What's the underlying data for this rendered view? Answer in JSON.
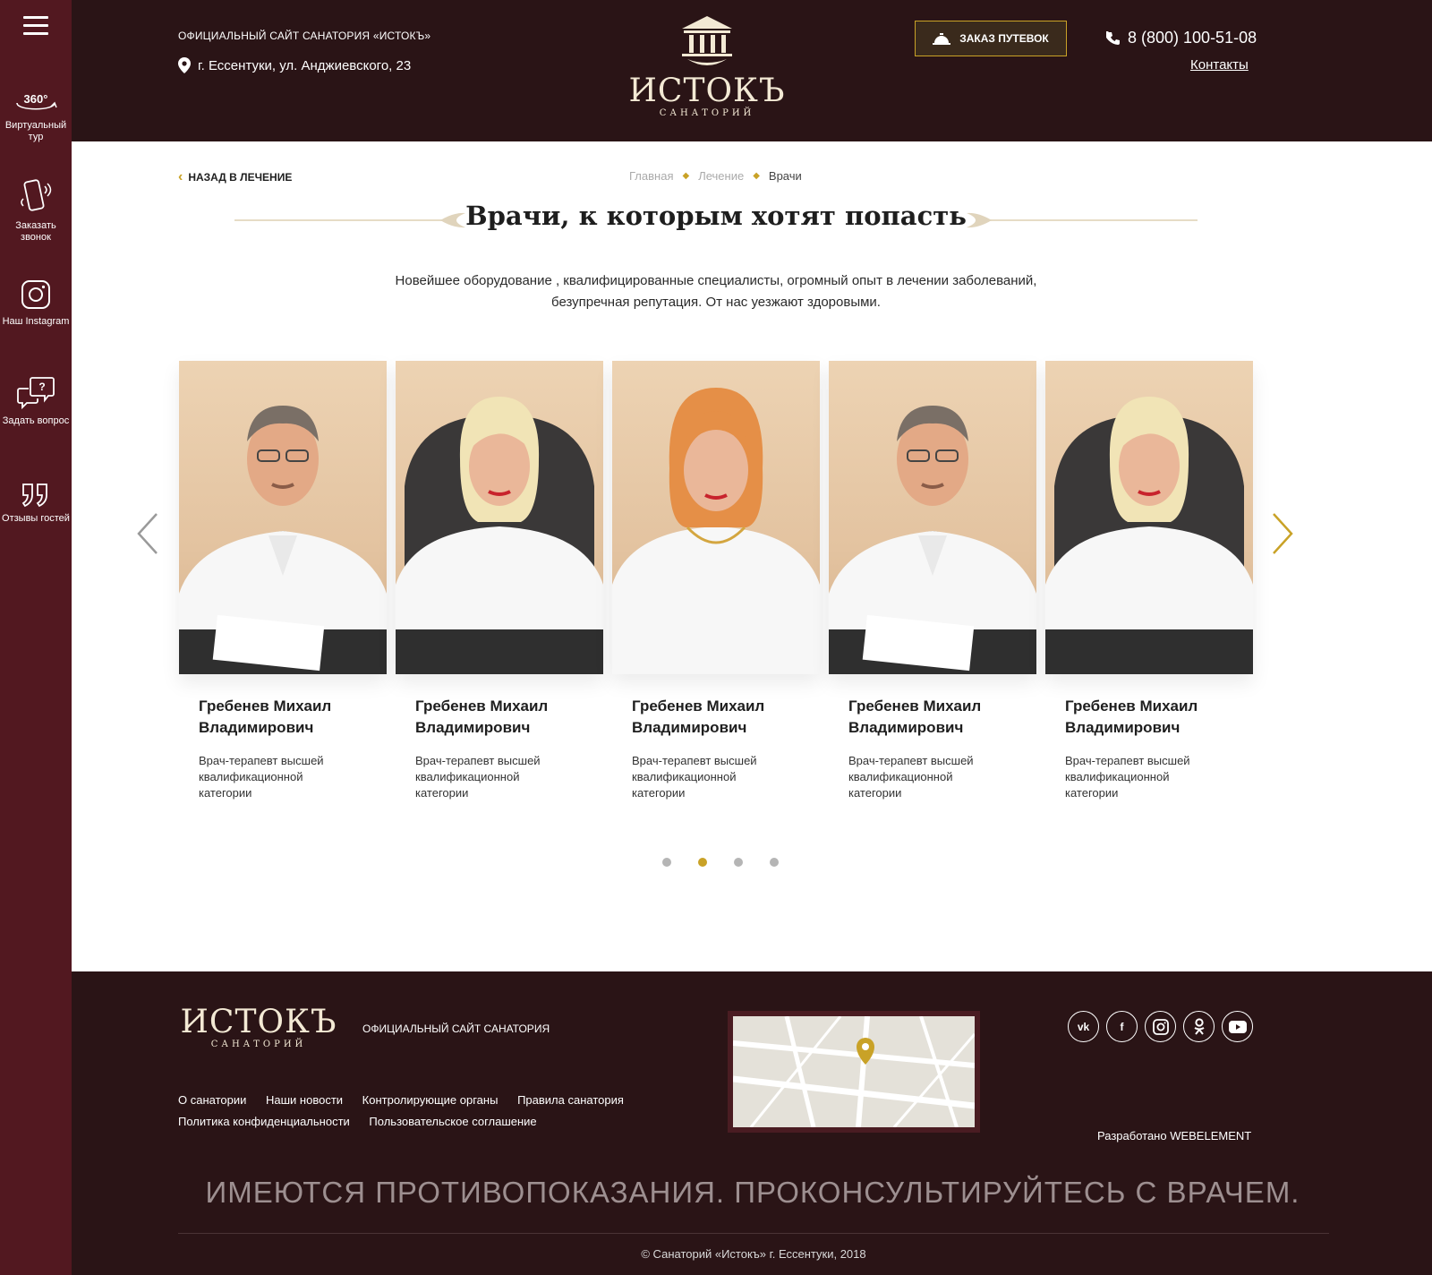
{
  "sidebar": {
    "items": [
      {
        "icon": "360-icon",
        "label": "Виртуальный тур"
      },
      {
        "icon": "phone-call-icon",
        "label": "Заказать звонок"
      },
      {
        "icon": "instagram-icon",
        "label": "Наш Instagram"
      },
      {
        "icon": "question-chat-icon",
        "label": "Задать вопрос"
      },
      {
        "icon": "quote-icon",
        "label": "Отзывы гостей"
      }
    ]
  },
  "header": {
    "official": "ОФИЦИАЛЬНЫЙ САЙТ САНАТОРИЯ «ИСТОКЪ»",
    "address": "г. Ессентуки, ул. Анджиевского, 23",
    "logo_name": "ИСТОКЪ",
    "logo_sub": "САНАТОРИЙ",
    "order_button": "ЗАКАЗ ПУТЕВОК",
    "phone": "8 (800) 100-51-08",
    "contacts": "Контакты"
  },
  "content": {
    "back_link": "НАЗАД В ЛЕЧЕНИЕ",
    "breadcrumbs": [
      "Главная",
      "Лечение",
      "Врачи"
    ],
    "title": "Врачи, к которым хотят попасть",
    "intro": "Новейшее оборудование , квалифицированные специалисты, огромный опыт в лечении заболеваний, безупречная репутация. От нас уезжают здоровыми."
  },
  "doctors": [
    {
      "name": "Гребенев Михаил Владимирович",
      "role": "Врач-терапевт высшей квалификационной категории"
    },
    {
      "name": "Гребенев Михаил Владимирович",
      "role": "Врач-терапевт высшей квалификационной категории"
    },
    {
      "name": "Гребенев Михаил Владимирович",
      "role": "Врач-терапевт высшей квалификационной категории"
    },
    {
      "name": "Гребенев Михаил Владимирович",
      "role": "Врач-терапевт высшей квалификационной категории"
    },
    {
      "name": "Гребенев Михаил Владимирович",
      "role": "Врач-терапевт высшей квалификационной категории"
    }
  ],
  "pagination": {
    "count": 4,
    "active_index": 1
  },
  "footer": {
    "logo_name": "ИСТОКЪ",
    "logo_sub": "САНАТОРИЙ",
    "official": "ОФИЦИАЛЬНЫЙ САЙТ САНАТОРИЯ",
    "links": [
      "О санатории",
      "Наши новости",
      "Контролирующие органы",
      "Правила санатория",
      "Политика конфиденциальности",
      "Пользовательское соглашение"
    ],
    "socials": [
      "vk-icon",
      "facebook-icon",
      "instagram-icon",
      "odnoklassniki-icon",
      "youtube-icon"
    ],
    "developer": "Разработано WEBELEMENT",
    "warning": "ИМЕЮТСЯ ПРОТИВОПОКАЗАНИЯ. ПРОКОНСУЛЬТИРУЙТЕСЬ С ВРАЧЕМ.",
    "copyright": "© Санаторий «Истокъ» г. Ессентуки, 2018"
  },
  "colors": {
    "sidebar": "#521820",
    "header": "#2a1416",
    "accent": "#c9a227"
  }
}
